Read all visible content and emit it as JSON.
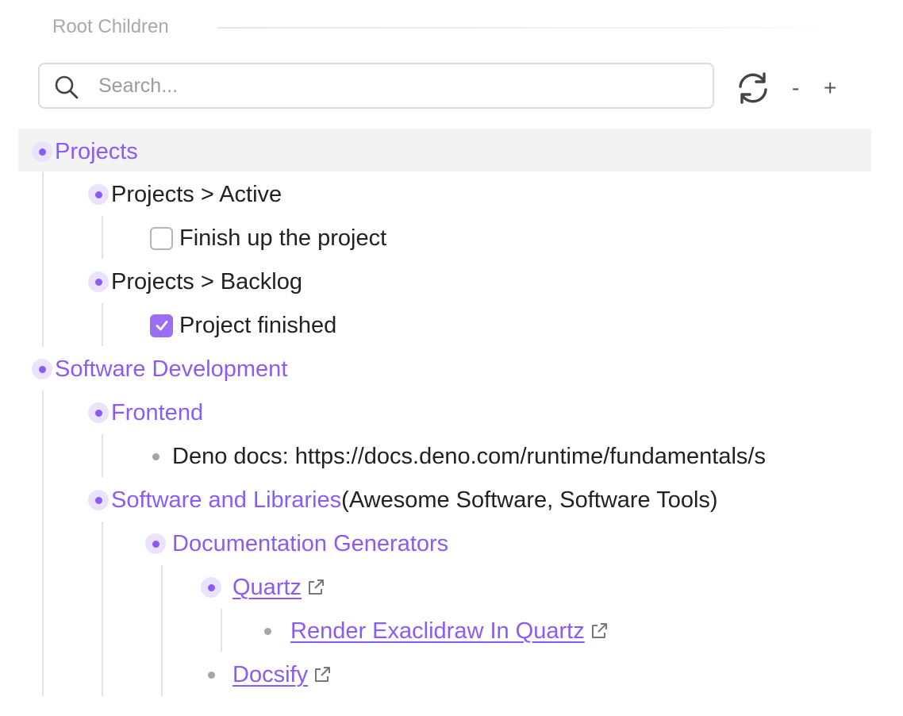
{
  "section": {
    "title": "Root Children"
  },
  "search": {
    "placeholder": "Search...",
    "value": ""
  },
  "toolbar": {
    "zoom_out_label": "-",
    "zoom_in_label": "+"
  },
  "tree": {
    "projects": "Projects",
    "projects_active": "Projects > Active",
    "task_finish": "Finish up the project",
    "task_finish_checked": false,
    "projects_backlog": "Projects > Backlog",
    "task_done": "Project finished",
    "task_done_checked": true,
    "software_dev": "Software Development",
    "frontend": "Frontend",
    "deno_docs": "Deno docs: https://docs.deno.com/runtime/fundamentals/s",
    "software_libraries": "Software and Libraries",
    "software_libraries_aliases": "(Awesome Software, Software Tools)",
    "doc_generators": "Documentation Generators",
    "quartz": "Quartz",
    "render_excalidraw": "Render Exaclidraw In Quartz",
    "docsify": "Docsify"
  },
  "colors": {
    "accent": "#8a5cf5",
    "bullet_ring": "#ebe3fb",
    "checkbox_checked": "#9b6ff5",
    "row_highlight": "#f3f3f3"
  },
  "icons": [
    "search-icon",
    "refresh-icon",
    "external-link-icon",
    "checkmark-icon"
  ]
}
